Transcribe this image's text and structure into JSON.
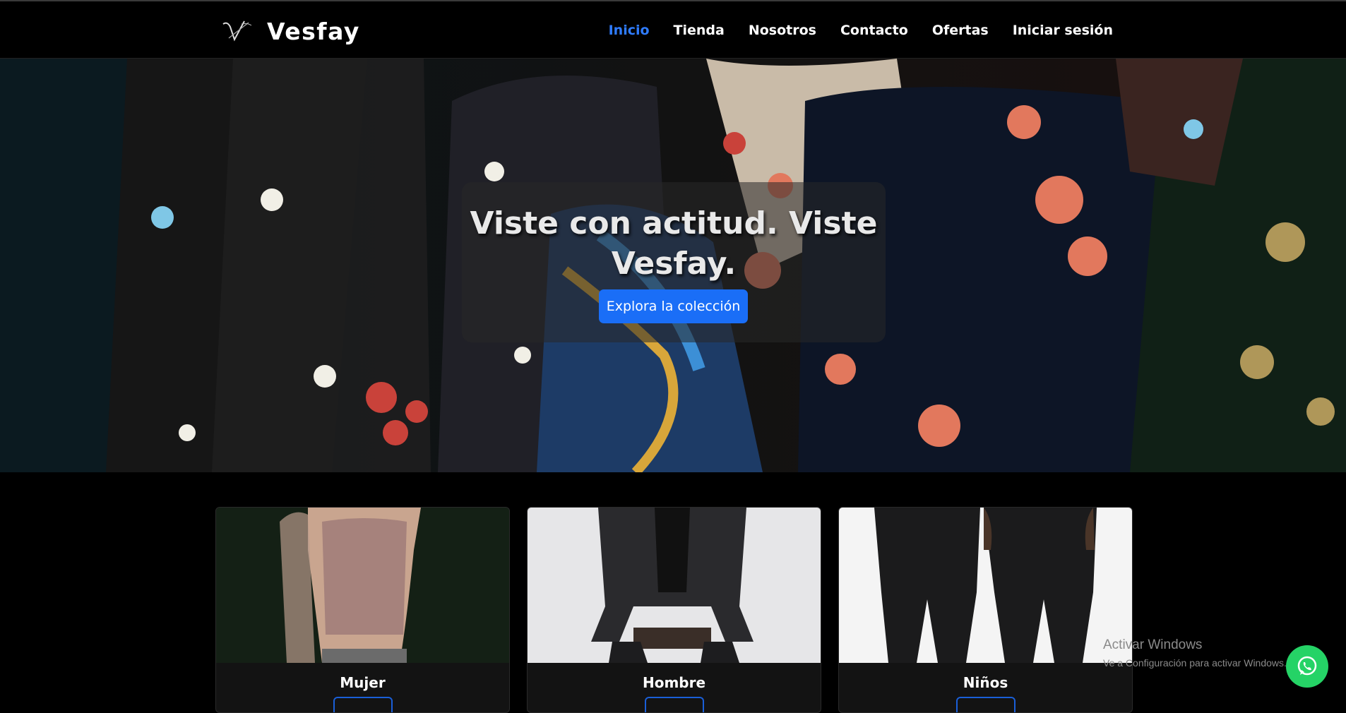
{
  "brand": {
    "name": "Vesfay",
    "logo_icon": "vesfay-monogram-icon"
  },
  "nav": {
    "items": [
      {
        "label": "Inicio",
        "active": true
      },
      {
        "label": "Tienda",
        "active": false
      },
      {
        "label": "Nosotros",
        "active": false
      },
      {
        "label": "Contacto",
        "active": false
      },
      {
        "label": "Ofertas",
        "active": false
      },
      {
        "label": "Iniciar sesión",
        "active": false
      }
    ],
    "active_color": "#2f7cff"
  },
  "hero": {
    "title": "Viste con actitud. Viste Vesfay.",
    "cta_label": "Explora la colección",
    "cta_color": "#1a6ef7"
  },
  "categories": [
    {
      "title": "Mujer"
    },
    {
      "title": "Hombre"
    },
    {
      "title": "Niños"
    }
  ],
  "watermark": {
    "title": "Activar Windows",
    "subtitle": "Ve a Configuración para activar Windows."
  },
  "whatsapp": {
    "icon": "whatsapp-icon",
    "color": "#25d366"
  }
}
